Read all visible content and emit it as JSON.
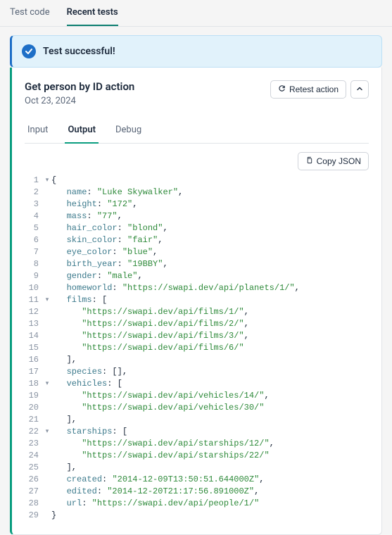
{
  "top_tabs": {
    "code": "Test code",
    "recent": "Recent tests"
  },
  "banner": {
    "text": "Test successful!"
  },
  "card": {
    "title": "Get person by ID action",
    "date": "Oct 23, 2024",
    "retest_label": "Retest action",
    "copy_label": "Copy JSON"
  },
  "inner_tabs": {
    "input": "Input",
    "output": "Output",
    "debug": "Debug"
  },
  "output_data": {
    "name": "Luke Skywalker",
    "height": "172",
    "mass": "77",
    "hair_color": "blond",
    "skin_color": "fair",
    "eye_color": "blue",
    "birth_year": "19BBY",
    "gender": "male",
    "homeworld": "https://swapi.dev/api/planets/1/",
    "films": [
      "https://swapi.dev/api/films/1/",
      "https://swapi.dev/api/films/2/",
      "https://swapi.dev/api/films/3/",
      "https://swapi.dev/api/films/6/"
    ],
    "species": [],
    "vehicles": [
      "https://swapi.dev/api/vehicles/14/",
      "https://swapi.dev/api/vehicles/30/"
    ],
    "starships": [
      "https://swapi.dev/api/starships/12/",
      "https://swapi.dev/api/starships/22/"
    ],
    "created": "2014-12-09T13:50:51.644000Z",
    "edited": "2014-12-20T21:17:56.891000Z",
    "url": "https://swapi.dev/api/people/1/"
  }
}
